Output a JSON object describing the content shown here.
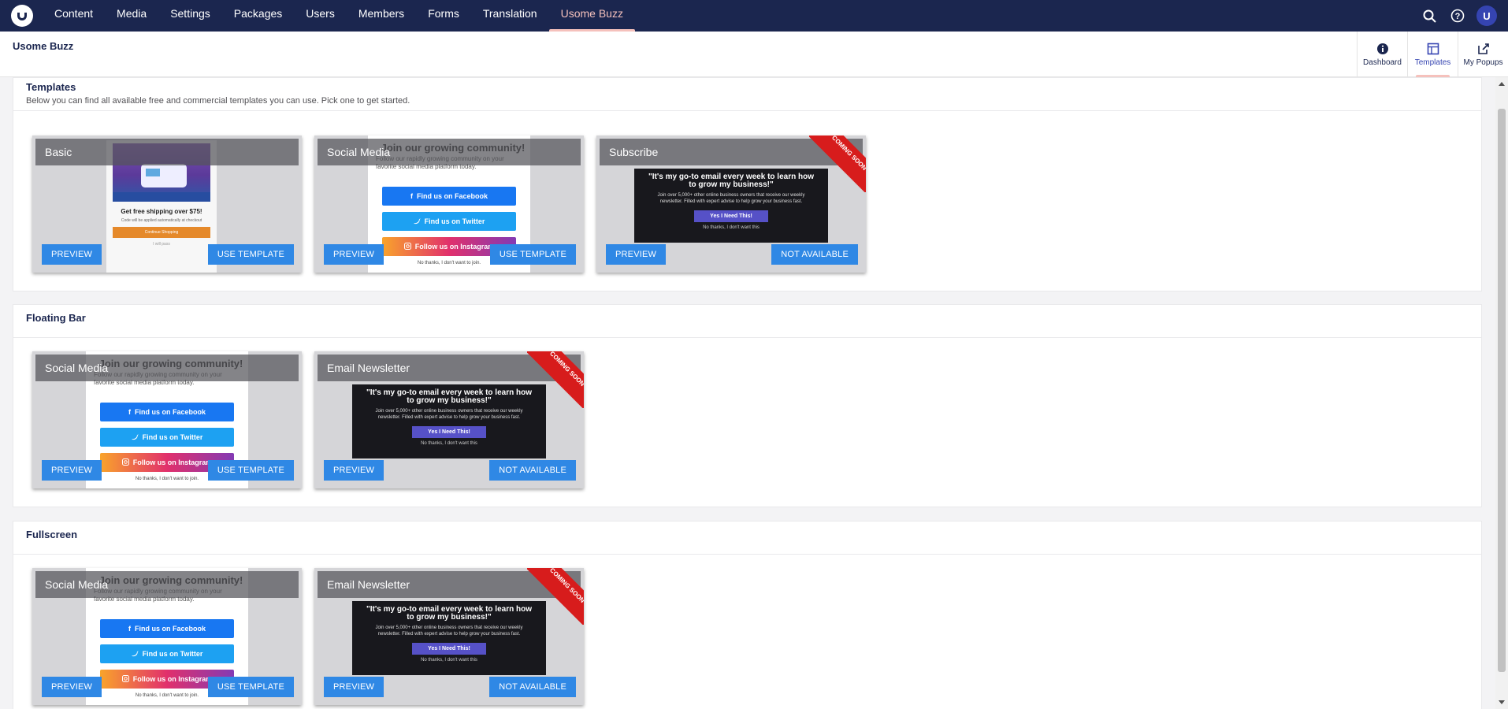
{
  "nav": {
    "items": [
      "Content",
      "Media",
      "Settings",
      "Packages",
      "Users",
      "Members",
      "Forms",
      "Translation",
      "Usome Buzz"
    ],
    "active": "Usome Buzz",
    "user_initial": "U"
  },
  "header": {
    "title": "Usome Buzz",
    "apps": [
      {
        "label": "Dashboard",
        "icon": "info-icon"
      },
      {
        "label": "Templates",
        "icon": "templates-icon",
        "active": true
      },
      {
        "label": "My Popups",
        "icon": "popup-edit-icon"
      }
    ]
  },
  "sections": [
    {
      "title": "Templates",
      "description": "Below you can find all available free and commercial templates you can use. Pick one to get started.",
      "cards": [
        {
          "label": "Basic",
          "preview_type": "basic",
          "left_button": "PREVIEW",
          "right_button": "USE TEMPLATE",
          "coming_soon": false
        },
        {
          "label": "Social Media",
          "preview_type": "social",
          "left_button": "PREVIEW",
          "right_button": "USE TEMPLATE",
          "coming_soon": false
        },
        {
          "label": "Subscribe",
          "preview_type": "email",
          "left_button": "PREVIEW",
          "right_button": "NOT AVAILABLE",
          "coming_soon": true
        }
      ]
    },
    {
      "title": "Floating Bar",
      "description": "",
      "cards": [
        {
          "label": "Social Media",
          "preview_type": "social",
          "left_button": "PREVIEW",
          "right_button": "USE TEMPLATE",
          "coming_soon": false
        },
        {
          "label": "Email Newsletter",
          "preview_type": "email",
          "left_button": "PREVIEW",
          "right_button": "NOT AVAILABLE",
          "coming_soon": true
        }
      ]
    },
    {
      "title": "Fullscreen",
      "description": "",
      "cards": [
        {
          "label": "Social Media",
          "preview_type": "social",
          "left_button": "PREVIEW",
          "right_button": "USE TEMPLATE",
          "coming_soon": false
        },
        {
          "label": "Email Newsletter",
          "preview_type": "email",
          "left_button": "PREVIEW",
          "right_button": "NOT AVAILABLE",
          "coming_soon": true
        }
      ]
    }
  ],
  "ribbon_text": "Coming Soon",
  "previews": {
    "basic": {
      "title": "Get free shipping over $75!",
      "subtitle": "Code will be applied automatically at checkout",
      "button": "Continue Shopping",
      "dismiss": "I will pass"
    },
    "social": {
      "title": "Join our growing community!",
      "subtitle": "Follow our rapidly growing community on your favorite social media platform today.",
      "facebook": "Find us on Facebook",
      "twitter": "Find us on Twitter",
      "instagram": "Follow us on Instagram",
      "dismiss": "No thanks, I don't want to join."
    },
    "email": {
      "quote": "\"It's my go-to email every week to learn how to grow my business!\"",
      "subtitle": "Join over 5,000+ other online business owners that receive our weekly newsletter. Filled with expert advise to help grow your business fast.",
      "button": "Yes I Need This!",
      "dismiss": "No thanks, I don't want this"
    }
  },
  "colors": {
    "topbar": "#1b264f",
    "accent": "#f5c1bc",
    "button": "#2f88e5",
    "ribbon": "#d71c1c"
  }
}
